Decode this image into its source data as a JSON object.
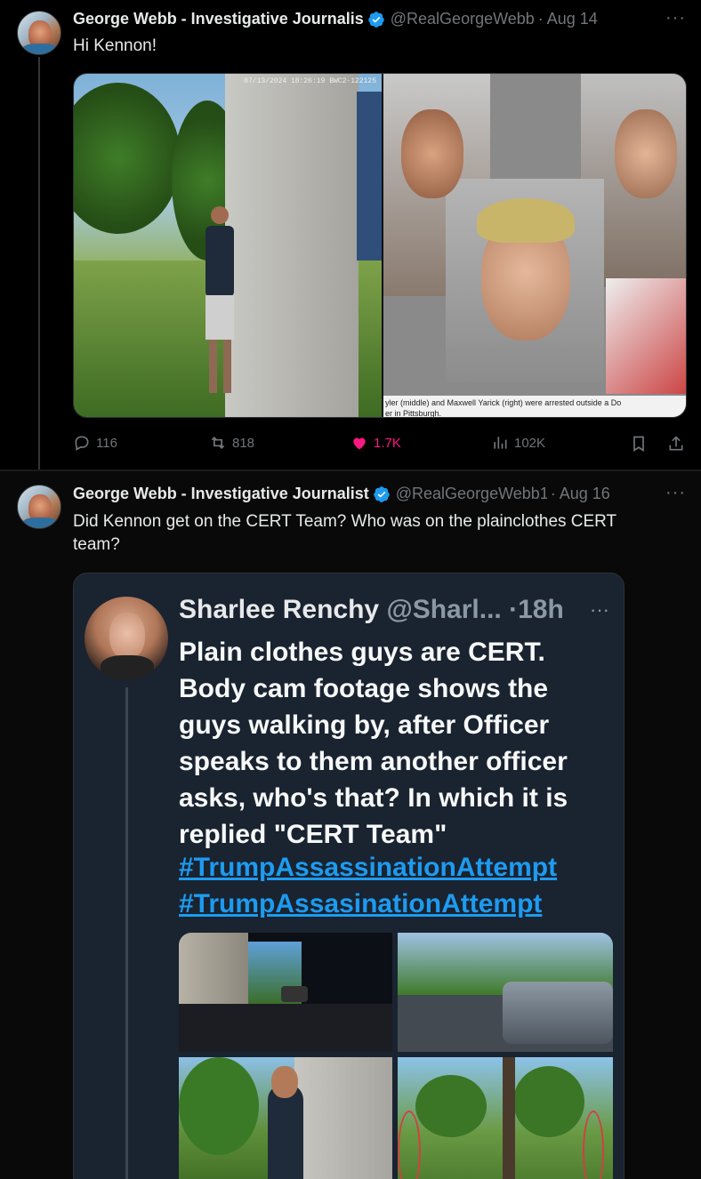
{
  "tweet1": {
    "author_name": "George Webb - Investigative Journalis",
    "handle": "@RealGeorgeWebb1",
    "separator": "·",
    "date": "Aug 14",
    "text": "Hi Kennon!",
    "media": {
      "left_stamp": "07/13/2024 18:26:19  BWC2-122125",
      "right_caption": "yler (middle) and Maxwell Yarick (right) were arrested outside a Do",
      "right_caption_2": "er in Pittsburgh."
    },
    "stats": {
      "replies": "116",
      "reposts": "818",
      "likes": "1.7K",
      "views": "102K"
    }
  },
  "tweet2": {
    "author_name": "George Webb - Investigative Journalist",
    "handle": "@RealGeorgeWebb1",
    "separator": "·",
    "date": "Aug 16",
    "text_line1": "Did Kennon get on the CERT Team?  Who was on the plainclothes CERT",
    "text_line2": "team?"
  },
  "quote": {
    "author_name": "Sharlee Renchy",
    "handle": "@Sharl...",
    "separator": "·",
    "time": "18h",
    "lines": [
      "Plain clothes guys are CERT.",
      "Body cam footage shows the",
      "guys walking by, after Officer",
      "speaks to them another officer",
      "asks, who's that? In which it is",
      "replied \"CERT Team\""
    ],
    "hashtags": [
      "#TrumpAssassinationAttempt",
      "#TrumpAssasinationAttempt"
    ]
  },
  "icons": [
    "verified-badge-icon",
    "more-icon",
    "reply-icon",
    "repost-icon",
    "like-icon",
    "views-icon",
    "bookmark-icon",
    "share-icon"
  ],
  "colors": {
    "background": "#000000",
    "text": "#e7e9ea",
    "secondary": "#71767b",
    "accent": "#1d9bf0",
    "like": "#f91880",
    "quote_bg": "#1a2330"
  }
}
